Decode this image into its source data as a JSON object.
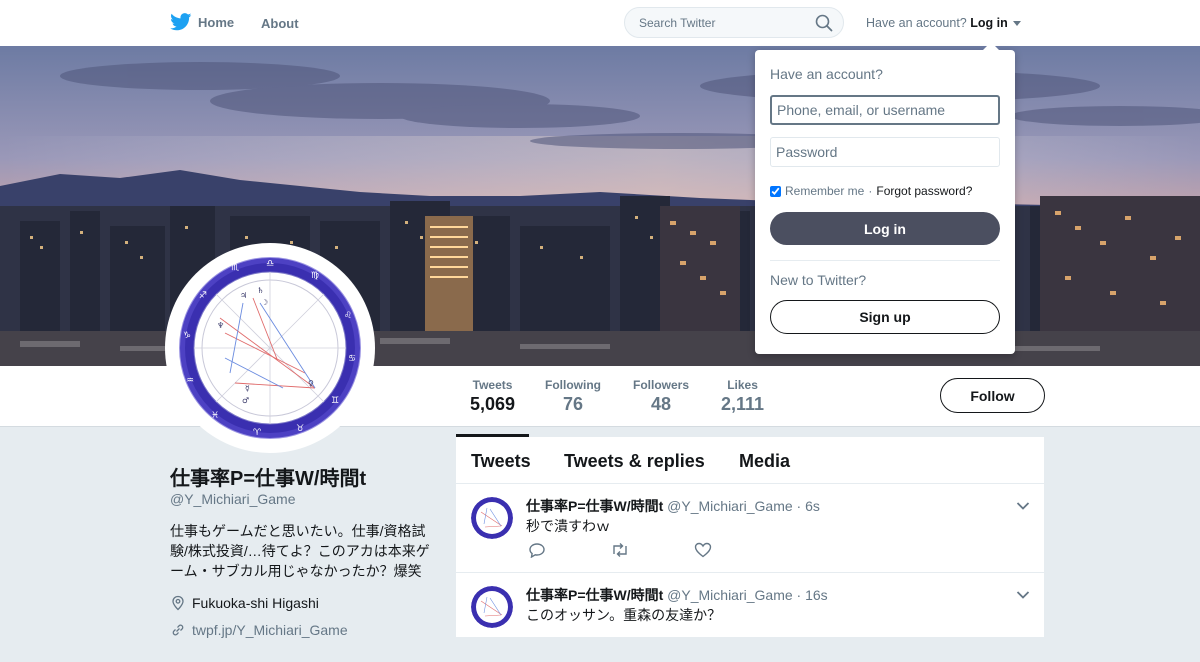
{
  "header": {
    "home_label": "Home",
    "about_label": "About",
    "search_placeholder": "Search Twitter",
    "have_account": "Have an account?",
    "login_label": "Log in"
  },
  "profile": {
    "name": "仕事率P=仕事W/時間t",
    "handle": "@Y_Michiari_Game",
    "bio": "仕事もゲームだと思いたい。仕事/資格試験/株式投資/…待てよ？このアカは本来ゲーム・サブカル用じゃなかったか？爆笑",
    "location": "Fukuoka-shi Higashi",
    "url": "twpf.jp/Y_Michiari_Game"
  },
  "stats": [
    {
      "label": "Tweets",
      "value": "5,069"
    },
    {
      "label": "Following",
      "value": "76"
    },
    {
      "label": "Followers",
      "value": "48"
    },
    {
      "label": "Likes",
      "value": "2,111"
    }
  ],
  "follow_label": "Follow",
  "timeline": {
    "tabs": [
      "Tweets",
      "Tweets & replies",
      "Media"
    ],
    "tweets": [
      {
        "name": "仕事率P=仕事W/時間t",
        "handle": "@Y_Michiari_Game",
        "time": "· 6s",
        "text": "秒で潰すわｗ"
      },
      {
        "name": "仕事率P=仕事W/時間t",
        "handle": "@Y_Michiari_Game",
        "time": "· 16s",
        "text": "このオッサン。重森の友達か？"
      }
    ]
  },
  "login_dropdown": {
    "title": "Have an account?",
    "username_placeholder": "Phone, email, or username",
    "password_placeholder": "Password",
    "remember_label": "Remember me",
    "separator": "·",
    "forgot_label": "Forgot password?",
    "login_button": "Log in",
    "new_label": "New to Twitter?",
    "signup_button": "Sign up"
  },
  "colors": {
    "brand": "#1da1f2",
    "button_dark": "#4b4f60",
    "background": "#e6ecf0"
  },
  "icons": [
    "twitter-bird-icon",
    "search-icon",
    "location-icon",
    "link-icon",
    "reply-icon",
    "retweet-icon",
    "like-icon",
    "chevron-down-icon"
  ]
}
